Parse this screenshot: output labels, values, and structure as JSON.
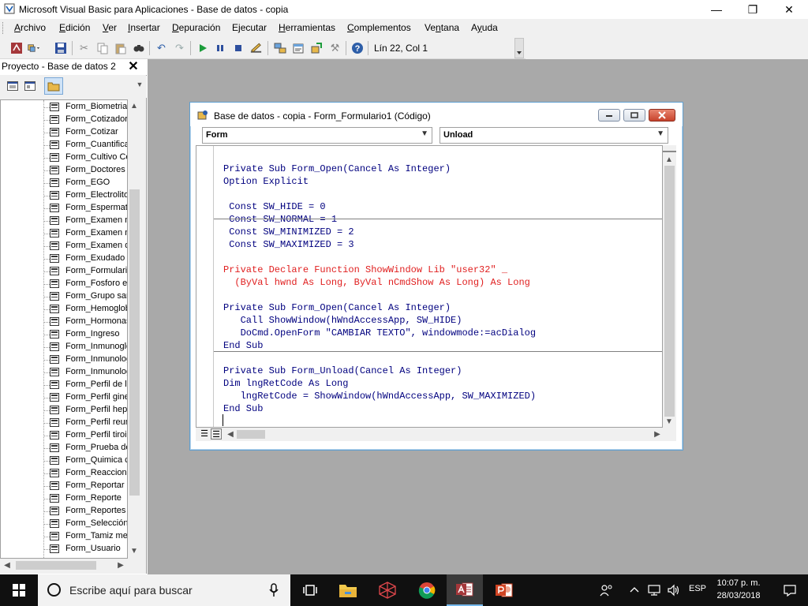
{
  "window": {
    "title": "Microsoft Visual Basic para Aplicaciones - Base de datos - copia",
    "minimize": "—",
    "maximize": "❐",
    "close": "✕"
  },
  "menu": [
    {
      "label": "Archivo",
      "mnemonic": "A"
    },
    {
      "label": "Edición",
      "mnemonic": "E"
    },
    {
      "label": "Ver",
      "mnemonic": "V"
    },
    {
      "label": "Insertar",
      "mnemonic": "I"
    },
    {
      "label": "Depuración",
      "mnemonic": "D"
    },
    {
      "label": "Ejecutar",
      "mnemonic": "j"
    },
    {
      "label": "Herramientas",
      "mnemonic": "H"
    },
    {
      "label": "Complementos",
      "mnemonic": "C"
    },
    {
      "label": "Ventana",
      "mnemonic": "n"
    },
    {
      "label": "Ayuda",
      "mnemonic": "y"
    }
  ],
  "toolbar": {
    "status": "Lín 22, Col 1",
    "icons": [
      "access-icon",
      "insert-dropdown-icon",
      "save-icon",
      "cut-icon",
      "copy-icon",
      "paste-icon",
      "find-icon",
      "undo-icon",
      "redo-icon",
      "run-icon",
      "break-icon",
      "reset-icon",
      "design-mode-icon",
      "project-explorer-icon",
      "properties-icon",
      "object-browser-icon",
      "toolbox-icon",
      "help-icon"
    ]
  },
  "project": {
    "title": "Proyecto - Base de datos 2",
    "close": "✕",
    "items": [
      "Form_Biometria h",
      "Form_Cotizador",
      "Form_Cotizar",
      "Form_Cuantifica",
      "Form_Cultivo Ce",
      "Form_Doctores",
      "Form_EGO",
      "Form_Electrolitos",
      "Form_Espermato",
      "Form_Examen m",
      "Form_Examen m",
      "Form_Examen qu",
      "Form_Exudado",
      "Form_Formulario",
      "Form_Fosforo er",
      "Form_Grupo san",
      "Form_Hemoglobi",
      "Form_Hormonas",
      "Form_Ingreso",
      "Form_Inmunoglo",
      "Form_Inmunolog",
      "Form_Inmunolog",
      "Form_Perfil de lip",
      "Form_Perfil gine",
      "Form_Perfil hepa",
      "Form_Perfil reum",
      "Form_Perfil tiroic",
      "Form_Prueba de",
      "Form_Quimica cli",
      "Form_Reaccione",
      "Form_Reportar",
      "Form_Reporte",
      "Form_Reportes",
      "Form_Selección",
      "Form_Tamiz met",
      "Form_Usuario"
    ]
  },
  "code_window": {
    "title": "Base de datos - copia - Form_Formulario1 (Código)",
    "object_combo": "Form",
    "procedure_combo": "Unload",
    "lines": [
      {
        "text": "Private Sub Form_Open(Cancel As Integer)",
        "kind": "normal"
      },
      {
        "text": "Option Explicit",
        "kind": "normal"
      },
      {
        "text": "",
        "kind": "normal"
      },
      {
        "text": " Const SW_HIDE = 0",
        "kind": "normal"
      },
      {
        "text": " Const SW_NORMAL = 1",
        "kind": "normal"
      },
      {
        "text": " Const SW_MINIMIZED = 2",
        "kind": "normal"
      },
      {
        "text": " Const SW_MAXIMIZED = 3",
        "kind": "normal"
      },
      {
        "text": "",
        "kind": "normal"
      },
      {
        "text": "Private Declare Function ShowWindow Lib \"user32\" _",
        "kind": "error"
      },
      {
        "text": "  (ByVal hwnd As Long, ByVal nCmdShow As Long) As Long",
        "kind": "error"
      },
      {
        "text": "",
        "kind": "normal"
      },
      {
        "text": "Private Sub Form_Open(Cancel As Integer)",
        "kind": "normal"
      },
      {
        "text": "   Call ShowWindow(hWndAccessApp, SW_HIDE)",
        "kind": "normal"
      },
      {
        "text": "   DoCmd.OpenForm \"CAMBIAR TEXTO\", windowmode:=acDialog",
        "kind": "normal"
      },
      {
        "text": "End Sub",
        "kind": "normal"
      },
      {
        "text": "",
        "kind": "normal"
      },
      {
        "text": "Private Sub Form_Unload(Cancel As Integer)",
        "kind": "normal"
      },
      {
        "text": "Dim lngRetCode As Long",
        "kind": "normal"
      },
      {
        "text": "   lngRetCode = ShowWindow(hWndAccessApp, SW_MAXIMIZED)",
        "kind": "normal"
      },
      {
        "text": "End Sub",
        "kind": "normal"
      }
    ]
  },
  "taskbar": {
    "search_placeholder": "Escribe aquí para buscar",
    "language": "ESP",
    "time": "10:07 p. m.",
    "date": "28/03/2018"
  },
  "colors": {
    "code_keyword": "#00007f",
    "code_error": "#e02020",
    "mdi_background": "#a9a9a9"
  }
}
